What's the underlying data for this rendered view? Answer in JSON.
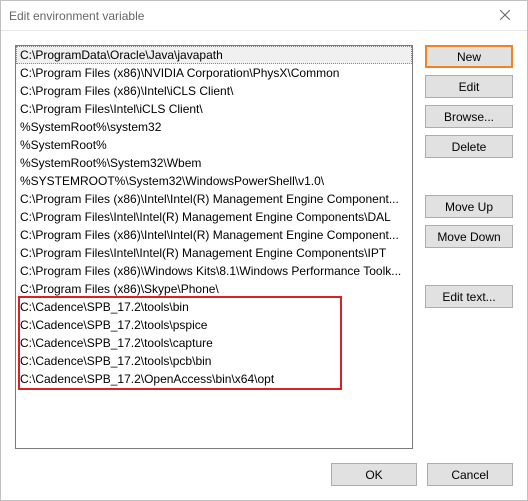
{
  "window": {
    "title": "Edit environment variable"
  },
  "list": {
    "items": [
      "C:\\ProgramData\\Oracle\\Java\\javapath",
      "C:\\Program Files (x86)\\NVIDIA Corporation\\PhysX\\Common",
      "C:\\Program Files (x86)\\Intel\\iCLS Client\\",
      "C:\\Program Files\\Intel\\iCLS Client\\",
      "%SystemRoot%\\system32",
      "%SystemRoot%",
      "%SystemRoot%\\System32\\Wbem",
      "%SYSTEMROOT%\\System32\\WindowsPowerShell\\v1.0\\",
      "C:\\Program Files (x86)\\Intel\\Intel(R) Management Engine Component...",
      "C:\\Program Files\\Intel\\Intel(R) Management Engine Components\\DAL",
      "C:\\Program Files (x86)\\Intel\\Intel(R) Management Engine Component...",
      "C:\\Program Files\\Intel\\Intel(R) Management Engine Components\\IPT",
      "C:\\Program Files (x86)\\Windows Kits\\8.1\\Windows Performance Toolk...",
      "C:\\Program Files (x86)\\Skype\\Phone\\",
      "C:\\Cadence\\SPB_17.2\\tools\\bin",
      "C:\\Cadence\\SPB_17.2\\tools\\pspice",
      "C:\\Cadence\\SPB_17.2\\tools\\capture",
      "C:\\Cadence\\SPB_17.2\\tools\\pcb\\bin",
      "C:\\Cadence\\SPB_17.2\\OpenAccess\\bin\\x64\\opt"
    ],
    "selected_index": 0
  },
  "buttons": {
    "new": "New",
    "edit": "Edit",
    "browse": "Browse...",
    "delete": "Delete",
    "move_up": "Move Up",
    "move_down": "Move Down",
    "edit_text": "Edit text...",
    "ok": "OK",
    "cancel": "Cancel"
  },
  "highlight": {
    "color": "#d62424",
    "start_index": 14,
    "end_index": 18
  }
}
